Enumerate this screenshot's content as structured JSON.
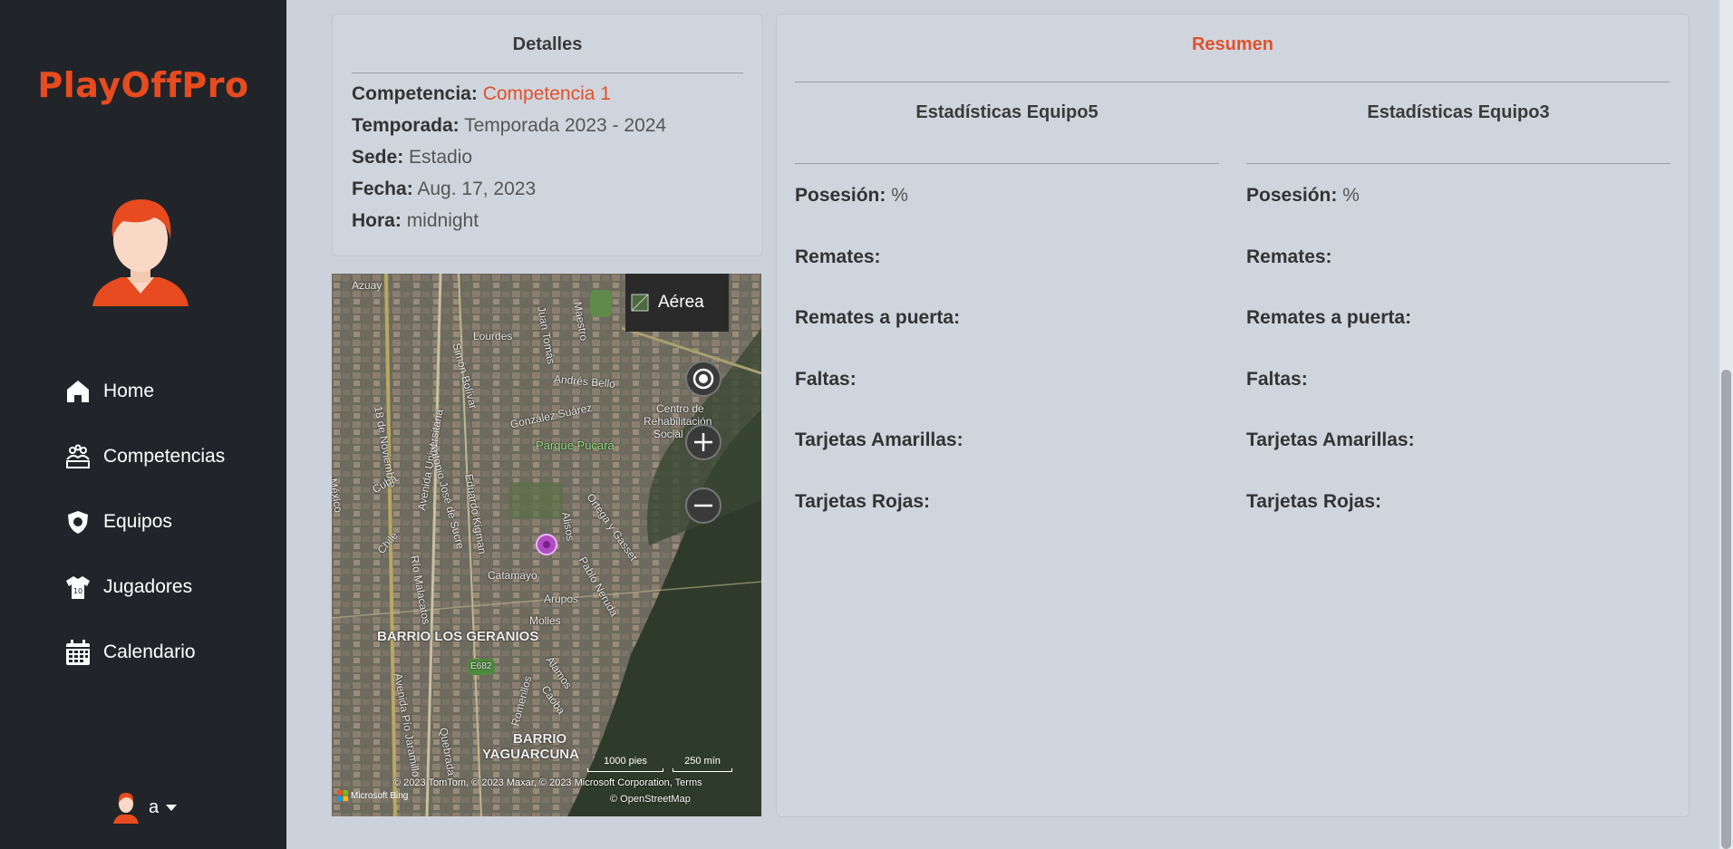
{
  "brand": "PlayOffPro",
  "nav": [
    {
      "label": "Home",
      "icon": "home-icon"
    },
    {
      "label": "Competencias",
      "icon": "competencias-icon"
    },
    {
      "label": "Equipos",
      "icon": "equipos-icon"
    },
    {
      "label": "Jugadores",
      "icon": "jersey-icon"
    },
    {
      "label": "Calendario",
      "icon": "calendar-icon"
    }
  ],
  "user": {
    "name": "a"
  },
  "detalles": {
    "title": "Detalles",
    "competencia_label": "Competencia:",
    "competencia_value": "Competencia 1",
    "temporada_label": "Temporada:",
    "temporada_value": "Temporada 2023 - 2024",
    "sede_label": "Sede:",
    "sede_value": "Estadio",
    "fecha_label": "Fecha:",
    "fecha_value": "Aug. 17, 2023",
    "hora_label": "Hora:",
    "hora_value": "midnight"
  },
  "map": {
    "mode_label": "Aérea",
    "labels": [
      "Azuay",
      "Lourdes",
      "18 de Noviembre",
      "Simón Bolívar",
      "Juan Tomás",
      "Maestro",
      "Andrés Bello",
      "González Suárez",
      "Centro de",
      "Rehabilitación",
      "Social",
      "Parque Pucará",
      "Avenida Universitaria",
      "Antonio José de Sucre",
      "Eduardo Kigman",
      "Cuba",
      "México",
      "Chile",
      "Ortega y Gasset",
      "Alisos",
      "Catamayo",
      "Pablo Neruda",
      "Río Malacatos",
      "Arupos",
      "Molles",
      "BARRIO LOS GERANIOS",
      "Alamos",
      "Caoba",
      "Romerillos",
      "Avenida Pío Jaramillo",
      "BARRIO",
      "YAGUARCUNA",
      "E682",
      "Quebrada"
    ],
    "scale_feet": "1000 pies",
    "scale_meters": "250 mín",
    "copyright": "© 2023 TomTom, © 2023 Maxar, © 2023 Microsoft Corporation,   Terms",
    "osm": "© OpenStreetMap",
    "bing": "Microsoft Bing"
  },
  "resumen": {
    "title": "Resumen",
    "teams": [
      {
        "title": "Estadísticas Equipo5",
        "stats": [
          {
            "label": "Posesión:",
            "value": "%"
          },
          {
            "label": "Remates:",
            "value": ""
          },
          {
            "label": "Remates a puerta:",
            "value": ""
          },
          {
            "label": "Faltas:",
            "value": ""
          },
          {
            "label": "Tarjetas Amarillas:",
            "value": ""
          },
          {
            "label": "Tarjetas Rojas:",
            "value": ""
          }
        ]
      },
      {
        "title": "Estadísticas Equipo3",
        "stats": [
          {
            "label": "Posesión:",
            "value": "%"
          },
          {
            "label": "Remates:",
            "value": ""
          },
          {
            "label": "Remates a puerta:",
            "value": ""
          },
          {
            "label": "Faltas:",
            "value": ""
          },
          {
            "label": "Tarjetas Amarillas:",
            "value": ""
          },
          {
            "label": "Tarjetas Rojas:",
            "value": ""
          }
        ]
      }
    ]
  },
  "colors": {
    "accent": "#e84b1f",
    "sidebar": "#212529",
    "background": "#ccd2db"
  }
}
